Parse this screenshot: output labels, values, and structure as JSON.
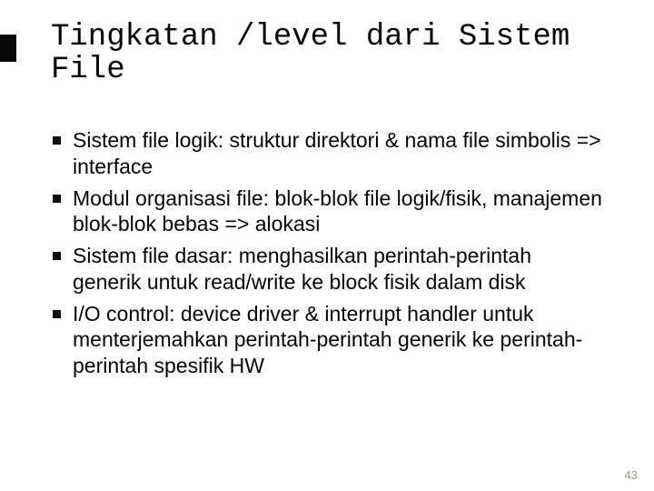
{
  "slide": {
    "title": "Tingkatan /level dari Sistem File",
    "bullets": [
      "Sistem file logik: struktur direktori & nama file simbolis => interface",
      "Modul organisasi file: blok-blok file logik/fisik, manajemen blok-blok bebas => alokasi",
      "Sistem file dasar: menghasilkan perintah-perintah generik untuk read/write ke block fisik dalam disk",
      "I/O control: device driver & interrupt handler untuk menterjemahkan perintah-perintah generik ke perintah-perintah spesifik HW"
    ],
    "page_number": "43"
  }
}
